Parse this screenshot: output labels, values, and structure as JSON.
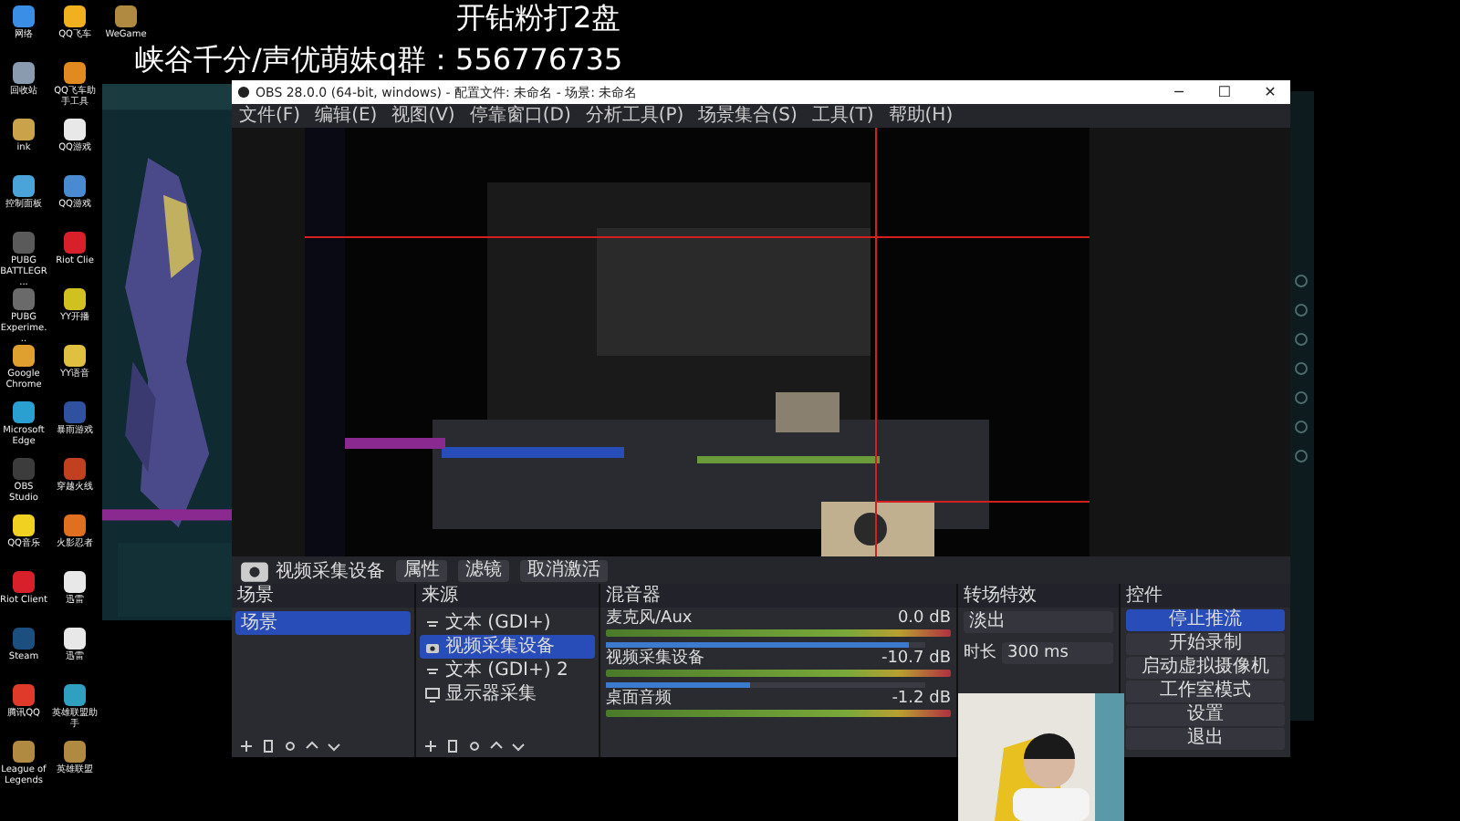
{
  "overlay": {
    "title": "开钻粉打2盘",
    "subtitle": "峡谷千分/声优萌妹q群：556776735"
  },
  "desktop_columns": [
    {
      "icons": [
        {
          "label": "网络",
          "color": "#3a8ee6"
        },
        {
          "label": "回收站",
          "color": "#8a9bb0"
        },
        {
          "label": "ink",
          "color": "#c9a24a"
        },
        {
          "label": "控制面板",
          "color": "#4aa3d9"
        },
        {
          "label": "PUBG BATTLEGR...",
          "color": "#5a5a5a"
        },
        {
          "label": "PUBG Experime...",
          "color": "#6a6a6a"
        },
        {
          "label": "Google Chrome",
          "color": "#e0a030"
        },
        {
          "label": "Microsoft Edge",
          "color": "#2aa0d0"
        },
        {
          "label": "OBS Studio",
          "color": "#3c3c3c"
        },
        {
          "label": "QQ音乐",
          "color": "#f0d020"
        },
        {
          "label": "Riot Client",
          "color": "#d8202a"
        },
        {
          "label": "Steam",
          "color": "#1b4f80"
        },
        {
          "label": "腾讯QQ",
          "color": "#e03a2a"
        },
        {
          "label": "League of Legends",
          "color": "#b08a40"
        }
      ]
    },
    {
      "icons": [
        {
          "label": "QQ飞车",
          "color": "#f0b020"
        },
        {
          "label": "QQ飞车助手工具",
          "color": "#e08a20"
        },
        {
          "label": "QQ游戏",
          "color": "#e8e8e8"
        },
        {
          "label": "QQ游戏",
          "color": "#4a8ad0"
        },
        {
          "label": "Riot Clie",
          "color": "#d8202a"
        },
        {
          "label": "YY开播",
          "color": "#d0c020"
        },
        {
          "label": "YY语音",
          "color": "#e0c040"
        },
        {
          "label": "暴雨游戏",
          "color": "#3050a0"
        },
        {
          "label": "穿越火线",
          "color": "#c04020"
        },
        {
          "label": "火影忍者",
          "color": "#e07020"
        },
        {
          "label": "迅雷",
          "color": "#e8e8e8"
        },
        {
          "label": "迅雷",
          "color": "#e8e8e8"
        },
        {
          "label": "英雄联盟助手",
          "color": "#30a0c0"
        },
        {
          "label": "英雄联盟",
          "color": "#b08a40"
        }
      ]
    },
    {
      "icons": [
        {
          "label": "WeGame",
          "color": "#b08a40"
        }
      ]
    }
  ],
  "obs": {
    "title": "OBS 28.0.0 (64-bit, windows) - 配置文件: 未命名 - 场景: 未命名",
    "window_buttons": [
      "─",
      "☐",
      "✕"
    ],
    "menu": [
      "文件(F)",
      "编辑(E)",
      "视图(V)",
      "停靠窗口(D)",
      "分析工具(P)",
      "场景集合(S)",
      "工具(T)",
      "帮助(H)"
    ],
    "source_toolbar": {
      "source": "视频采集设备",
      "buttons": [
        "属性",
        "滤镜",
        "取消激活"
      ]
    },
    "scenes": {
      "title": "场景",
      "items": [
        {
          "label": "场景",
          "selected": true
        }
      ]
    },
    "sources": {
      "title": "来源",
      "items": [
        {
          "label": "文本 (GDI+)",
          "kind": "text",
          "selected": false
        },
        {
          "label": "视频采集设备",
          "kind": "camera",
          "selected": true
        },
        {
          "label": "文本 (GDI+) 2",
          "kind": "text",
          "selected": false
        },
        {
          "label": "显示器采集",
          "kind": "monitor",
          "selected": false
        }
      ]
    },
    "mixer": {
      "title": "混音器",
      "channels": [
        {
          "name": "麦克风/Aux",
          "reading": "0.0 dB",
          "level": 0.95
        },
        {
          "name": "视频采集设备",
          "reading": "-10.7 dB",
          "level": 0.45
        },
        {
          "name": "桌面音频",
          "reading": "-1.2 dB"
        }
      ]
    },
    "transitions": {
      "title": "转场特效",
      "type": "淡出",
      "duration_label": "时长",
      "duration": "300 ms"
    },
    "controls": {
      "title": "控件",
      "buttons": [
        {
          "label": "停止推流",
          "selected": true
        },
        {
          "label": "开始录制",
          "selected": false
        },
        {
          "label": "启动虚拟摄像机",
          "selected": false
        },
        {
          "label": "工作室模式",
          "selected": false
        },
        {
          "label": "设置",
          "selected": false
        },
        {
          "label": "退出",
          "selected": false
        }
      ]
    }
  }
}
